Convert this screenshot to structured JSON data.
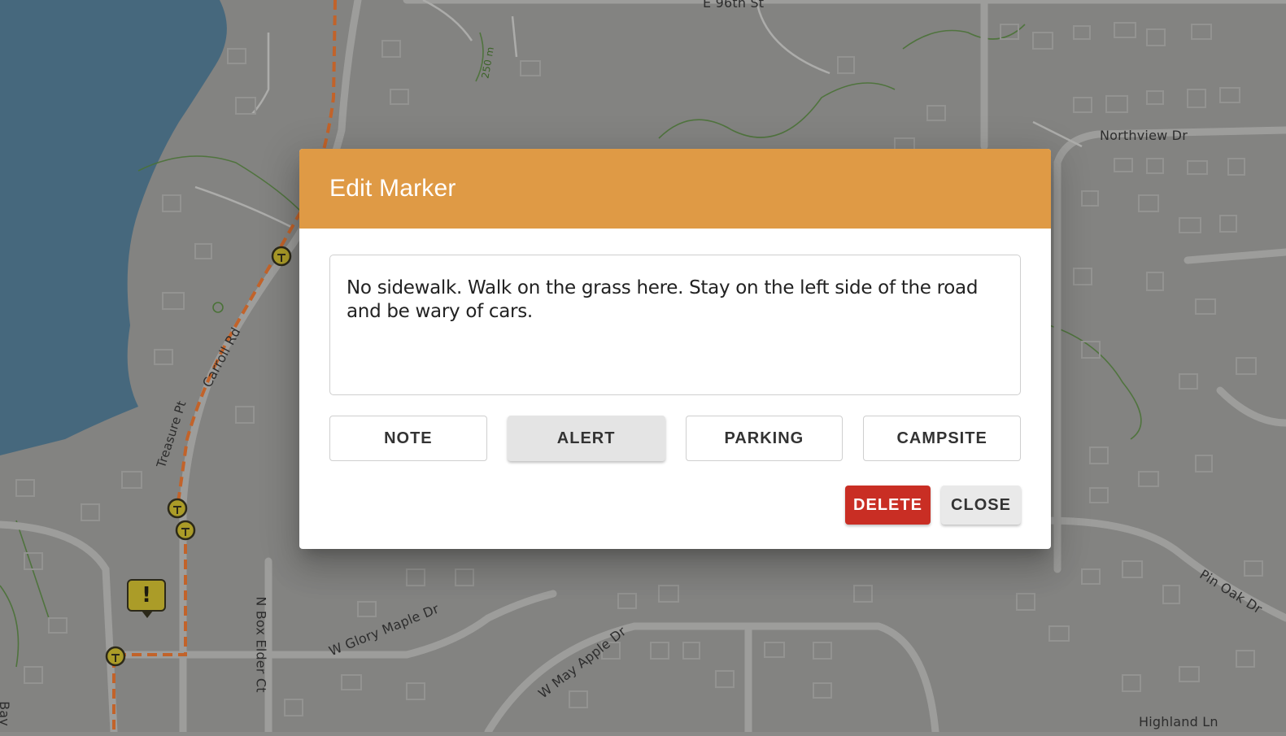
{
  "map": {
    "street_labels": [
      "E 96th St",
      "Northview Dr",
      "Carroll Rd",
      "Treasure Pt",
      "W Glory Maple Dr",
      "W May Apple Dr",
      "N Box Elder Ct",
      "Pin Oak Dr",
      "Highland Ln",
      "Bay",
      "250 m"
    ],
    "alert_marker_icon": "exclamation-marker-icon",
    "alert_marker_glyph": "!",
    "colors": {
      "water": "#4a6f86",
      "land": "#8c8c8a",
      "trail": "#d16a2c",
      "contour": "#4f7a3a"
    }
  },
  "dialog": {
    "title": "Edit Marker",
    "note_text": "No sidewalk. Walk on the grass here. Stay on the left side of the road and be wary of cars.",
    "marker_types": [
      {
        "label": "NOTE",
        "selected": false
      },
      {
        "label": "ALERT",
        "selected": true
      },
      {
        "label": "PARKING",
        "selected": false
      },
      {
        "label": "CAMPSITE",
        "selected": false
      }
    ],
    "delete_label": "DELETE",
    "close_label": "CLOSE",
    "colors": {
      "header": "#df9a45",
      "delete": "#c92e24"
    }
  }
}
